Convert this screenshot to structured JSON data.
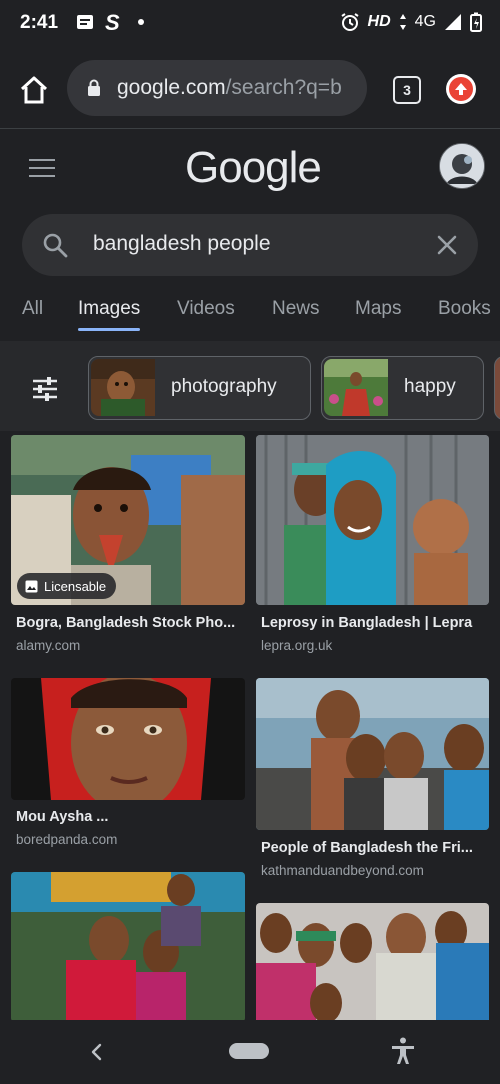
{
  "status_bar": {
    "time": "2:41",
    "indicators": "HD",
    "network": "4G",
    "left_icons": [
      "message-icon",
      "s-app-icon",
      "dot-icon"
    ],
    "right_icons": [
      "alarm-icon",
      "data-arrows-icon",
      "signal-icon",
      "battery-icon"
    ]
  },
  "browser": {
    "url_domain": "google.com",
    "url_path": "/search?q=b",
    "tab_count": "3"
  },
  "google": {
    "logo_text": "Google",
    "search_query": "bangladesh people"
  },
  "nav_tabs": [
    {
      "label": "All",
      "active": false
    },
    {
      "label": "Images",
      "active": true
    },
    {
      "label": "Videos",
      "active": false
    },
    {
      "label": "News",
      "active": false
    },
    {
      "label": "Maps",
      "active": false
    },
    {
      "label": "Books",
      "active": false
    }
  ],
  "chips": [
    {
      "label": "photography"
    },
    {
      "label": "happy"
    }
  ],
  "results": [
    {
      "title": "Bogra, Bangladesh Stock Pho...",
      "source": "alamy.com",
      "badge": "Licensable"
    },
    {
      "title": "Leprosy in Bangladesh | Lepra",
      "source": "lepra.org.uk"
    },
    {
      "title": "Mou Aysha ...",
      "source": "boredpanda.com"
    },
    {
      "title": "People of Bangladesh the Fri...",
      "source": "kathmanduandbeyond.com"
    }
  ],
  "colors": {
    "background": "#202124",
    "accent": "#8ab4f8",
    "update_badge": "#ea4335"
  }
}
